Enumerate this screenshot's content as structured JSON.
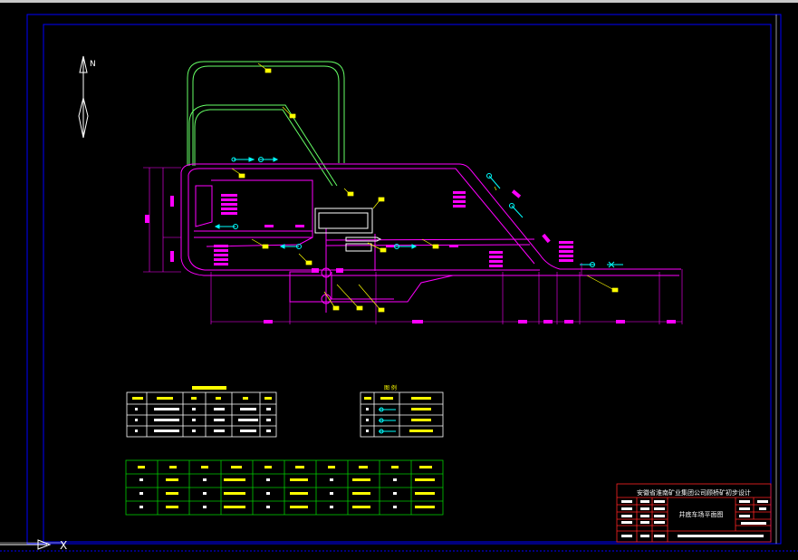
{
  "drawing": {
    "north_label": "N",
    "ucs_label": "X",
    "colors": {
      "background": "#000000",
      "border": "#0000ff",
      "track": "#ff00ff",
      "route": "#66ff66",
      "label": "#ffff00",
      "symbol": "#00ffff",
      "grid": "#00cc00",
      "title_block": "#ff2222"
    }
  },
  "title_block": {
    "company": "安徽省淮南矿业集团公司顾桥矿初步设计",
    "drawing_name": "井底车场平面图"
  },
  "legend": {
    "heading": "图 例"
  }
}
